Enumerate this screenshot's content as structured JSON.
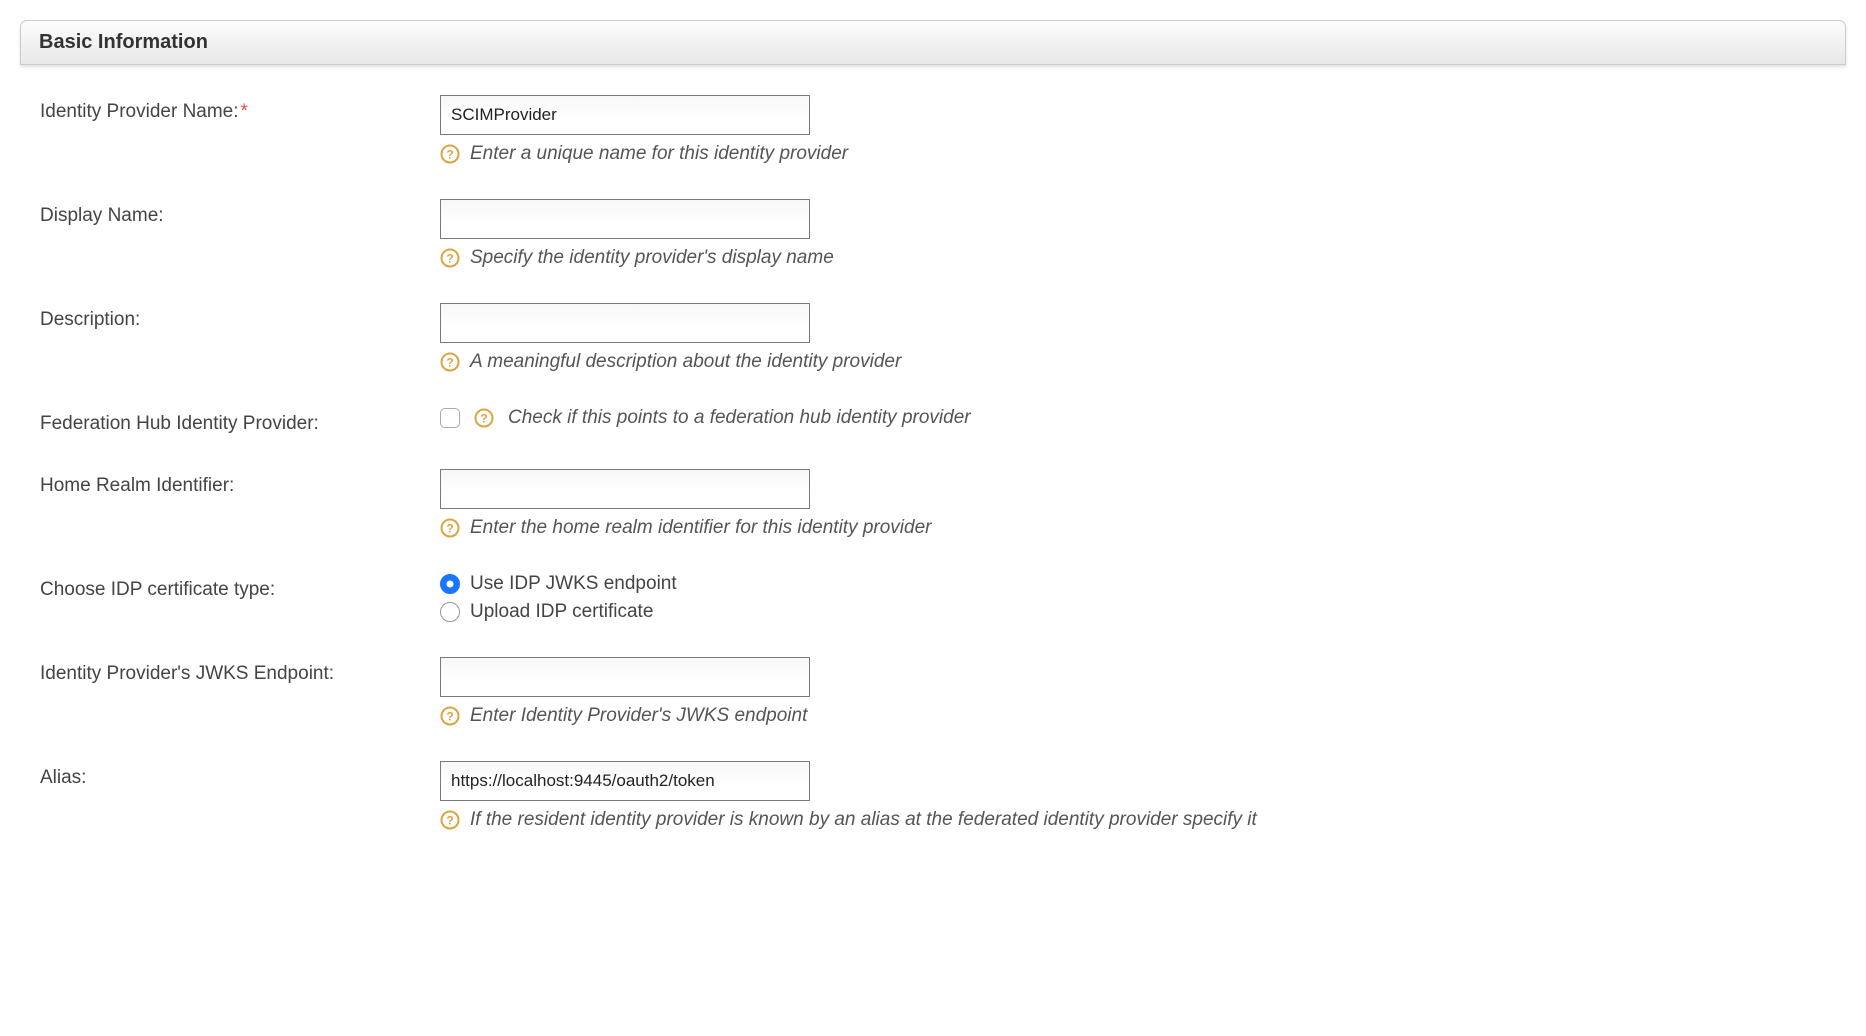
{
  "section": {
    "title": "Basic Information"
  },
  "fields": {
    "idp_name": {
      "label": "Identity Provider Name:",
      "required_mark": "*",
      "value": "SCIMProvider",
      "hint": "Enter a unique name for this identity provider"
    },
    "display_name": {
      "label": "Display Name:",
      "value": "",
      "hint": "Specify the identity provider's display name"
    },
    "description": {
      "label": "Description:",
      "value": "",
      "hint": "A meaningful description about the identity provider"
    },
    "federation_hub": {
      "label": "Federation Hub Identity Provider:",
      "hint": "Check if this points to a federation hub identity provider"
    },
    "home_realm": {
      "label": "Home Realm Identifier:",
      "value": "",
      "hint": "Enter the home realm identifier for this identity provider"
    },
    "cert_type": {
      "label": "Choose IDP certificate type:",
      "option_jwks": "Use IDP JWKS endpoint",
      "option_upload": "Upload IDP certificate"
    },
    "jwks_endpoint": {
      "label": "Identity Provider's JWKS Endpoint:",
      "value": "",
      "hint": "Enter Identity Provider's JWKS endpoint"
    },
    "alias": {
      "label": "Alias:",
      "value": "https://localhost:9445/oauth2/token",
      "hint": "If the resident identity provider is known by an alias at the federated identity provider specify it"
    }
  }
}
